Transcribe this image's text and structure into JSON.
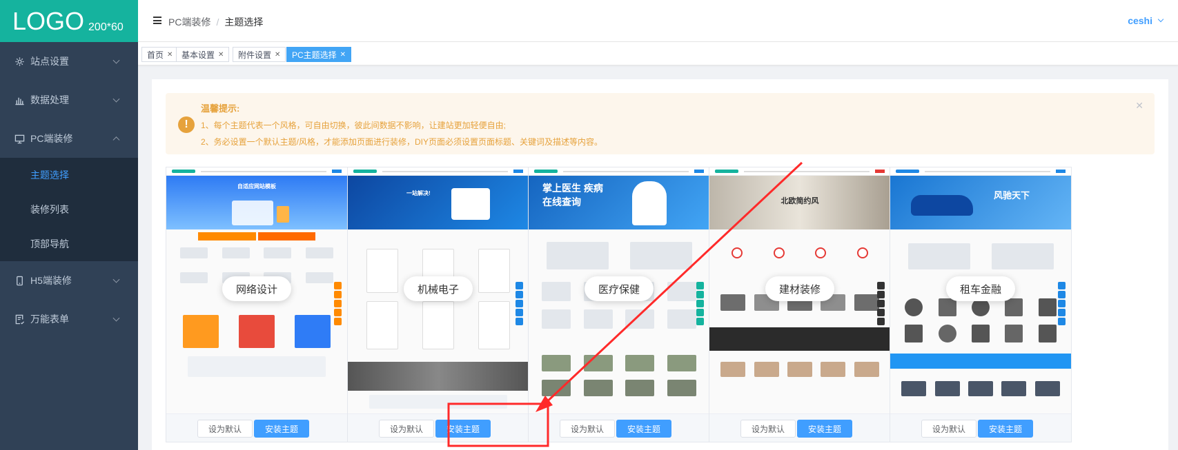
{
  "brand": {
    "logo_text": "LOGO",
    "logo_size": "200*60",
    "color": "#15b39e"
  },
  "sidebar": {
    "items": [
      {
        "label": "站点设置",
        "icon": "gear-icon"
      },
      {
        "label": "数据处理",
        "icon": "bar-chart-icon"
      },
      {
        "label": "PC端装修",
        "icon": "monitor-icon",
        "expanded": true,
        "children": [
          {
            "label": "主题选择",
            "active": true
          },
          {
            "label": "装修列表"
          },
          {
            "label": "顶部导航"
          }
        ]
      },
      {
        "label": "H5端装修",
        "icon": "mobile-icon"
      },
      {
        "label": "万能表单",
        "icon": "form-icon"
      }
    ]
  },
  "header": {
    "breadcrumb": [
      "PC端装修",
      "主题选择"
    ],
    "user": "ceshi"
  },
  "tags": [
    {
      "label": "首页"
    },
    {
      "label": "基本设置"
    },
    {
      "label": "附件设置"
    },
    {
      "label": "PC主题选择",
      "active": true
    }
  ],
  "alert": {
    "title": "温馨提示:",
    "line1": "1、每个主题代表一个风格，可自由切换，彼此间数据不影响，让建站更加轻便自由;",
    "line2": "2、务必设置一个默认主题/风格，才能添加页面进行装修，DIY页面必须设置页面标题、关键词及描述等内容。"
  },
  "themes": [
    {
      "name": "网络设计",
      "banner": "自适应网站模板",
      "accent": "#2f7cf6"
    },
    {
      "name": "机械电子",
      "banner": "一站解决!",
      "accent": "#1e64c8"
    },
    {
      "name": "医疗保健",
      "banner": "掌上医生 疾病在线查询",
      "accent": "#2196f3"
    },
    {
      "name": "建材装修",
      "banner": "北欧简约风",
      "accent": "#e53935"
    },
    {
      "name": "租车金融",
      "banner": "风驰天下",
      "accent": "#2196f3"
    }
  ],
  "buttons": {
    "set_default": "设为默认",
    "install": "安装主题"
  },
  "colors": {
    "sidebar_bg": "#304156",
    "active": "#409eff",
    "warning": "#e6a23c",
    "annotation": "#ff2a2a"
  }
}
